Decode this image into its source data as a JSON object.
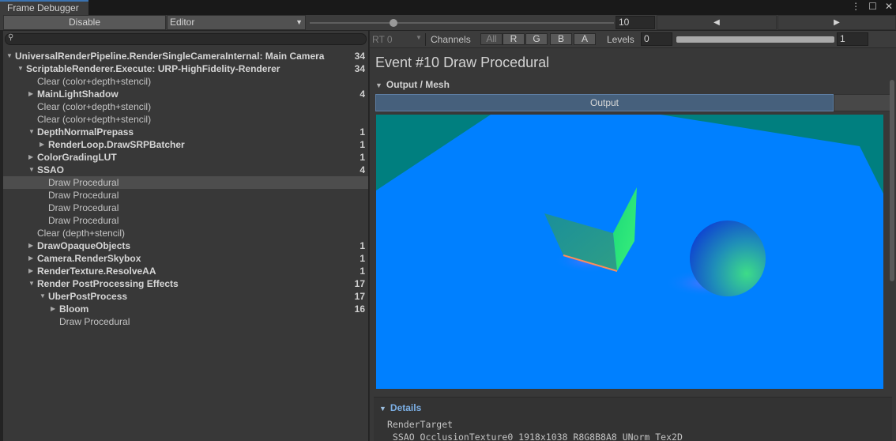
{
  "window": {
    "title": "Frame Debugger",
    "menu_icon": "kebab-menu-icon",
    "maximize_icon": "maximize-icon",
    "close_icon": "close-icon"
  },
  "toolbar": {
    "disable_label": "Disable",
    "target_value": "Editor",
    "event_index": "10",
    "event_slider_fraction": 0.27,
    "prev_glyph": "◀",
    "next_glyph": "▶"
  },
  "search": {
    "placeholder": "",
    "icon": "search-icon"
  },
  "tree": [
    {
      "depth": 0,
      "arrow": "expanded",
      "label": "UniversalRenderPipeline.RenderSingleCameraInternal: Main Camera",
      "count": "34",
      "bold": true
    },
    {
      "depth": 1,
      "arrow": "expanded",
      "label": "ScriptableRenderer.Execute: URP-HighFidelity-Renderer",
      "count": "34",
      "bold": true
    },
    {
      "depth": 2,
      "arrow": "none",
      "label": "Clear (color+depth+stencil)",
      "count": "",
      "bold": false
    },
    {
      "depth": 2,
      "arrow": "collapsed",
      "label": "MainLightShadow",
      "count": "4",
      "bold": true
    },
    {
      "depth": 2,
      "arrow": "none",
      "label": "Clear (color+depth+stencil)",
      "count": "",
      "bold": false
    },
    {
      "depth": 2,
      "arrow": "none",
      "label": "Clear (color+depth+stencil)",
      "count": "",
      "bold": false
    },
    {
      "depth": 2,
      "arrow": "expanded",
      "label": "DepthNormalPrepass",
      "count": "1",
      "bold": true
    },
    {
      "depth": 3,
      "arrow": "collapsed",
      "label": "RenderLoop.DrawSRPBatcher",
      "count": "1",
      "bold": true
    },
    {
      "depth": 2,
      "arrow": "collapsed",
      "label": "ColorGradingLUT",
      "count": "1",
      "bold": true
    },
    {
      "depth": 2,
      "arrow": "expanded",
      "label": "SSAO",
      "count": "4",
      "bold": true
    },
    {
      "depth": 3,
      "arrow": "none",
      "label": "Draw Procedural",
      "count": "",
      "bold": false,
      "selected": true
    },
    {
      "depth": 3,
      "arrow": "none",
      "label": "Draw Procedural",
      "count": "",
      "bold": false
    },
    {
      "depth": 3,
      "arrow": "none",
      "label": "Draw Procedural",
      "count": "",
      "bold": false
    },
    {
      "depth": 3,
      "arrow": "none",
      "label": "Draw Procedural",
      "count": "",
      "bold": false
    },
    {
      "depth": 2,
      "arrow": "none",
      "label": "Clear (depth+stencil)",
      "count": "",
      "bold": false
    },
    {
      "depth": 2,
      "arrow": "collapsed",
      "label": "DrawOpaqueObjects",
      "count": "1",
      "bold": true
    },
    {
      "depth": 2,
      "arrow": "collapsed",
      "label": "Camera.RenderSkybox",
      "count": "1",
      "bold": true
    },
    {
      "depth": 2,
      "arrow": "collapsed",
      "label": "RenderTexture.ResolveAA",
      "count": "1",
      "bold": true
    },
    {
      "depth": 2,
      "arrow": "expanded",
      "label": "Render PostProcessing Effects",
      "count": "17",
      "bold": true
    },
    {
      "depth": 3,
      "arrow": "expanded",
      "label": "UberPostProcess",
      "count": "17",
      "bold": true
    },
    {
      "depth": 4,
      "arrow": "collapsed",
      "label": "Bloom",
      "count": "16",
      "bold": true
    },
    {
      "depth": 4,
      "arrow": "none",
      "label": "Draw Procedural",
      "count": "",
      "bold": false
    }
  ],
  "rt_bar": {
    "rt_label": "RT 0",
    "channels_label": "Channels",
    "channels": [
      "All",
      "R",
      "G",
      "B",
      "A"
    ],
    "levels_label": "Levels",
    "levels_min": "0",
    "levels_max": "1"
  },
  "event": {
    "title": "Event #10 Draw Procedural",
    "section_label": "Output / Mesh",
    "output_tab": "Output"
  },
  "details": {
    "label": "Details",
    "render_target_key": "RenderTarget",
    "render_target_value": "_SSAO_OcclusionTexture0_1918x1038_R8G8B8A8_UNorm_Tex2D"
  },
  "colors": {
    "accent_tab": "#3a72b0",
    "viewport_floor": "#0080ff",
    "viewport_wall": "#007f7f",
    "details_header": "#7cb0e6"
  }
}
